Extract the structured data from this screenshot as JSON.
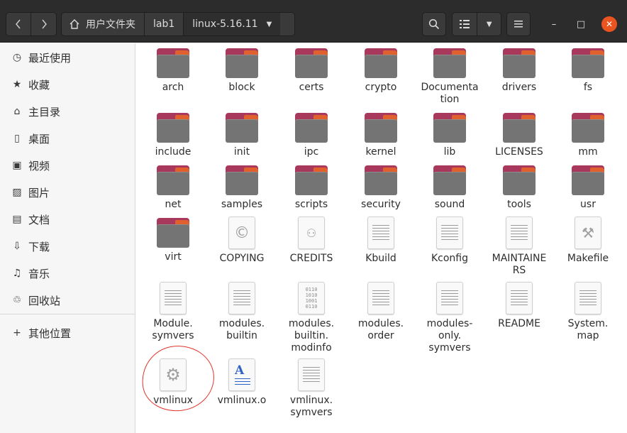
{
  "headerbar": {
    "back_icon": "chevron-left-icon",
    "forward_icon": "chevron-right-icon",
    "path": [
      {
        "label": "用户文件夹",
        "icon": "home-icon"
      },
      {
        "label": "lab1"
      },
      {
        "label": "linux-5.16.11"
      }
    ],
    "search_icon": "search-icon",
    "view_icon": "list-view-icon",
    "view_menu_icon": "chevron-down-icon",
    "menu_icon": "hamburger-icon",
    "minimize_symbol": "–",
    "maximize_symbol": "□",
    "close_symbol": "✕",
    "close_color": "#e95420"
  },
  "sidebar": {
    "items": [
      {
        "label": "最近使用",
        "icon": "clock-icon"
      },
      {
        "label": "收藏",
        "icon": "star-icon"
      },
      {
        "label": "主目录",
        "icon": "home-icon"
      },
      {
        "label": "桌面",
        "icon": "desktop-icon"
      },
      {
        "label": "视频",
        "icon": "video-icon"
      },
      {
        "label": "图片",
        "icon": "picture-icon"
      },
      {
        "label": "文档",
        "icon": "document-icon"
      },
      {
        "label": "下载",
        "icon": "download-icon"
      },
      {
        "label": "音乐",
        "icon": "music-icon"
      },
      {
        "label": "回收站",
        "icon": "trash-icon"
      }
    ],
    "other_locations": {
      "label": "其他位置",
      "icon": "plus-icon"
    }
  },
  "files": [
    {
      "name": "arch",
      "type": "folder"
    },
    {
      "name": "block",
      "type": "folder"
    },
    {
      "name": "certs",
      "type": "folder"
    },
    {
      "name": "crypto",
      "type": "folder"
    },
    {
      "name": "Documentation",
      "type": "folder"
    },
    {
      "name": "drivers",
      "type": "folder"
    },
    {
      "name": "fs",
      "type": "folder"
    },
    {
      "name": "include",
      "type": "folder"
    },
    {
      "name": "init",
      "type": "folder"
    },
    {
      "name": "ipc",
      "type": "folder"
    },
    {
      "name": "kernel",
      "type": "folder"
    },
    {
      "name": "lib",
      "type": "folder"
    },
    {
      "name": "LICENSES",
      "type": "folder"
    },
    {
      "name": "mm",
      "type": "folder"
    },
    {
      "name": "net",
      "type": "folder"
    },
    {
      "name": "samples",
      "type": "folder"
    },
    {
      "name": "scripts",
      "type": "folder"
    },
    {
      "name": "security",
      "type": "folder"
    },
    {
      "name": "sound",
      "type": "folder"
    },
    {
      "name": "tools",
      "type": "folder"
    },
    {
      "name": "usr",
      "type": "folder"
    },
    {
      "name": "virt",
      "type": "folder"
    },
    {
      "name": "COPYING",
      "type": "copyright"
    },
    {
      "name": "CREDITS",
      "type": "people"
    },
    {
      "name": "Kbuild",
      "type": "text"
    },
    {
      "name": "Kconfig",
      "type": "text"
    },
    {
      "name": "MAINTAINERS",
      "type": "text"
    },
    {
      "name": "Makefile",
      "type": "makefile"
    },
    {
      "name": "Module.symvers",
      "type": "text"
    },
    {
      "name": "modules.builtin",
      "type": "text"
    },
    {
      "name": "modules.builtin.modinfo",
      "type": "binary"
    },
    {
      "name": "modules.order",
      "type": "text"
    },
    {
      "name": "modules-only.symvers",
      "type": "text"
    },
    {
      "name": "README",
      "type": "text"
    },
    {
      "name": "System.map",
      "type": "text"
    },
    {
      "name": "vmlinux",
      "type": "executable"
    },
    {
      "name": "vmlinux.o",
      "type": "textdoc"
    },
    {
      "name": "vmlinux.symvers",
      "type": "text"
    }
  ],
  "labels": {
    "Documentation": "Documenta\ntion",
    "MAINTAINERS": "MAINTAINE\nRS",
    "Module.symvers": "Module.\nsymvers",
    "modules.builtin": "modules.\nbuiltin",
    "modules.builtin.modinfo": "modules.\nbuiltin.\nmodinfo",
    "modules.order": "modules.\norder",
    "modules-only.symvers": "modules-\nonly.\nsymvers",
    "System.map": "System.\nmap",
    "vmlinux.symvers": "vmlinux.\nsymvers"
  },
  "annotation_color": "#e0352b"
}
